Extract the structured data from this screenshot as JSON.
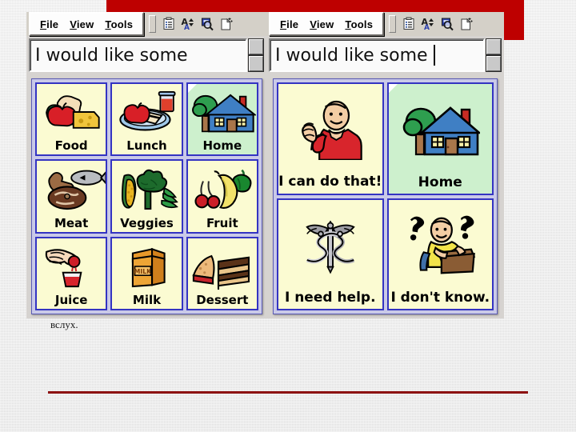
{
  "slide": {
    "caption": "вслух.",
    "accent_color": "#be0000",
    "rule_color": "#8d1212",
    "background_color": "#e8e8e8"
  },
  "windows": [
    {
      "id": "left",
      "menu": {
        "items": [
          "File",
          "View",
          "Tools"
        ]
      },
      "toolbar": {
        "icons": [
          "drag-handle",
          "list-properties-icon",
          "font-size-icon",
          "zoom-icon",
          "new-page-icon"
        ]
      },
      "textfield": {
        "value": "I would like some",
        "placeholder": "",
        "has_caret": false,
        "spinner": true
      },
      "grid": {
        "columns": 3,
        "rows": 3,
        "cells": [
          {
            "label": "Food",
            "art": "food",
            "style": "yellow",
            "stacked": false
          },
          {
            "label": "Lunch",
            "art": "lunch",
            "style": "yellow",
            "stacked": false
          },
          {
            "label": "Home",
            "art": "house",
            "style": "green",
            "stacked": true
          },
          {
            "label": "Meat",
            "art": "meat",
            "style": "yellow",
            "stacked": false
          },
          {
            "label": "Veggies",
            "art": "veggies",
            "style": "yellow",
            "stacked": false
          },
          {
            "label": "Fruit",
            "art": "fruit",
            "style": "yellow",
            "stacked": false
          },
          {
            "label": "Juice",
            "art": "juice",
            "style": "yellow",
            "stacked": false
          },
          {
            "label": "Milk",
            "art": "milk",
            "style": "yellow",
            "stacked": false
          },
          {
            "label": "Dessert",
            "art": "dessert",
            "style": "yellow",
            "stacked": false
          }
        ]
      }
    },
    {
      "id": "right",
      "menu": {
        "items": [
          "File",
          "View",
          "Tools"
        ]
      },
      "toolbar": {
        "icons": [
          "drag-handle",
          "list-properties-icon",
          "font-size-icon",
          "zoom-icon",
          "new-page-icon"
        ]
      },
      "textfield": {
        "value": "I would like some",
        "placeholder": "",
        "has_caret": true,
        "spinner": true
      },
      "grid": {
        "columns": 2,
        "rows": 2,
        "cells": [
          {
            "label": "I can do that!",
            "art": "person-flex",
            "style": "yellow",
            "stacked": false
          },
          {
            "label": "Home",
            "art": "house",
            "style": "green",
            "stacked": true
          },
          {
            "label": "I need help.",
            "art": "caduceus",
            "style": "yellow",
            "stacked": false
          },
          {
            "label": "I don't know.",
            "art": "person-unsure",
            "style": "yellow",
            "stacked": false
          }
        ]
      }
    }
  ],
  "icon_labels": {
    "drag-handle": "drag-handle",
    "list-properties-icon": "list-properties",
    "font-size-icon": "font-size",
    "zoom-icon": "zoom",
    "new-page-icon": "new-page"
  },
  "milk_carton_text": "MILK"
}
